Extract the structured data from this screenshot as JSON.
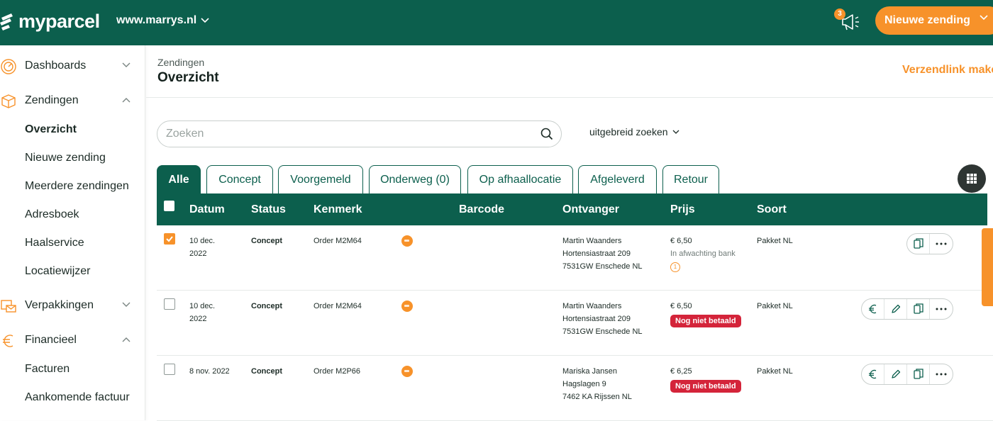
{
  "header": {
    "logo_text": "myparcel",
    "shop_name": "www.marrys.nl",
    "notification_count": "3",
    "new_shipment_label": "Nieuwe zending"
  },
  "sidebar": {
    "groups": [
      {
        "label": "Dashboards",
        "icon": "dashboard-icon",
        "expanded": false
      },
      {
        "label": "Zendingen",
        "icon": "box-icon",
        "expanded": true,
        "items": [
          "Overzicht",
          "Nieuwe zending",
          "Meerdere zendingen",
          "Adresboek",
          "Haalservice",
          "Locatiewijzer"
        ],
        "active": "Overzicht"
      },
      {
        "label": "Verpakkingen",
        "icon": "package-mail-icon",
        "expanded": false
      },
      {
        "label": "Financieel",
        "icon": "euro-icon",
        "expanded": true,
        "items": [
          "Facturen",
          "Aankomende factuur"
        ]
      }
    ]
  },
  "page": {
    "breadcrumb": "Zendingen",
    "title": "Overzicht",
    "shiplink_label": "Verzendlink maken"
  },
  "search": {
    "placeholder": "Zoeken",
    "value": "",
    "advanced_label": "uitgebreid zoeken"
  },
  "tabs": [
    "Alle",
    "Concept",
    "Voorgemeld",
    "Onderweg (0)",
    "Op afhaallocatie",
    "Afgeleverd",
    "Retour"
  ],
  "active_tab": "Alle",
  "table": {
    "columns": [
      "Datum",
      "Status",
      "Kenmerk",
      "Barcode",
      "Ontvanger",
      "Prijs",
      "Soort"
    ],
    "rows": [
      {
        "checked": true,
        "date_line1": "10 dec.",
        "date_line2": "2022",
        "status": "Concept",
        "reference": "Order M2M64",
        "carrier_icon": "postnl-icon",
        "barcode": "",
        "recipient_name": "Martin Waanders",
        "recipient_street": "Hortensiastraat 209",
        "recipient_city": "7531GW Enschede NL",
        "price": "€ 6,50",
        "payment_note": "In afwachting bank",
        "payment_badge": "",
        "info_count": "1",
        "type": "Pakket NL",
        "actions": [
          "copy-icon",
          "more-icon"
        ]
      },
      {
        "checked": false,
        "date_line1": "10 dec.",
        "date_line2": "2022",
        "status": "Concept",
        "reference": "Order M2M64",
        "carrier_icon": "postnl-icon",
        "barcode": "",
        "recipient_name": "Martin Waanders",
        "recipient_street": "Hortensiastraat 209",
        "recipient_city": "7531GW Enschede NL",
        "price": "€ 6,50",
        "payment_note": "",
        "payment_badge": "Nog niet betaald",
        "info_count": "",
        "type": "Pakket NL",
        "actions": [
          "euro-icon",
          "edit-icon",
          "copy-icon",
          "more-icon"
        ]
      },
      {
        "checked": false,
        "date_line1": "8 nov. 2022",
        "date_line2": "",
        "status": "Concept",
        "reference": "Order M2P66",
        "carrier_icon": "postnl-icon",
        "barcode": "",
        "recipient_name": "Mariska Jansen",
        "recipient_street": "Hagslagen 9",
        "recipient_city": "7462 KA Rijssen NL",
        "price": "€ 6,25",
        "payment_note": "",
        "payment_badge": "Nog niet betaald",
        "info_count": "",
        "type": "Pakket NL",
        "actions": [
          "euro-icon",
          "edit-icon",
          "copy-icon",
          "more-icon"
        ]
      }
    ]
  },
  "colors": {
    "brand_green": "#0c5f4d",
    "accent_orange": "#f7922a",
    "danger_red": "#d4243a"
  }
}
